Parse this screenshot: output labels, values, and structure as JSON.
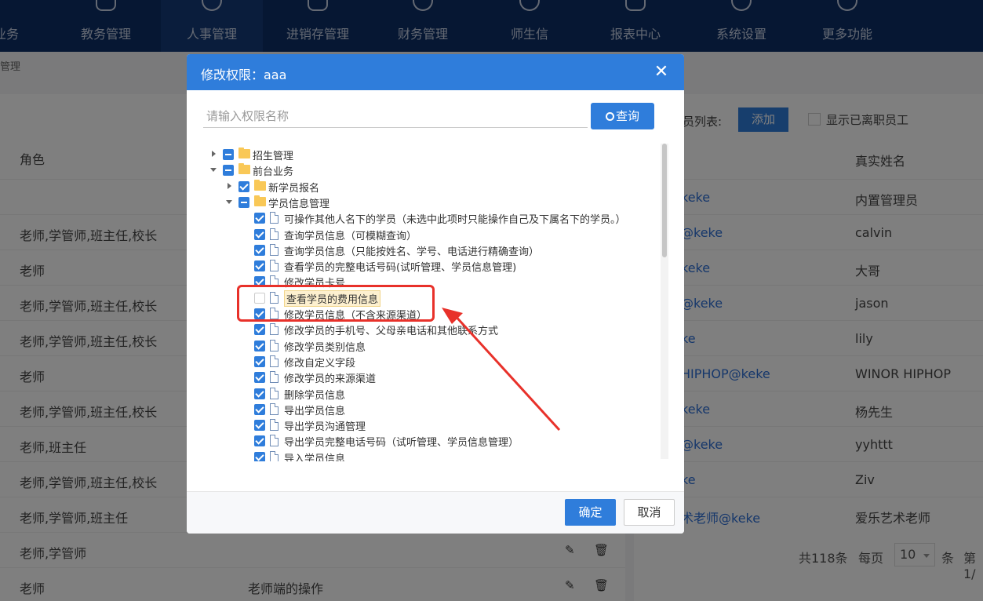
{
  "nav": {
    "items": [
      "业务",
      "教务管理",
      "人事管理",
      "进销存管理",
      "财务管理",
      "师生信",
      "报表中心",
      "系统设置",
      "更多功能"
    ],
    "active_index": 2
  },
  "breadcrumb": "管理",
  "background": {
    "left_header": "角色",
    "left_rows": [
      {
        "role": "",
        "desc": ""
      },
      {
        "role": "老师,学管师,班主任,校长",
        "desc": ""
      },
      {
        "role": "老师",
        "desc": ""
      },
      {
        "role": "老师,学管师,班主任,校长",
        "desc": ""
      },
      {
        "role": "老师,学管师,班主任,校长",
        "desc": ""
      },
      {
        "role": "老师",
        "desc": ""
      },
      {
        "role": "老师,学管师,班主任,校长",
        "desc": ""
      },
      {
        "role": "老师,班主任",
        "desc": ""
      },
      {
        "role": "老师,学管师,班主任,校长",
        "desc": ""
      },
      {
        "role": "老师,学管师,班主任",
        "desc": ""
      },
      {
        "role": "老师,学管师",
        "desc": ""
      },
      {
        "role": "老师",
        "desc": "老师端的操作"
      }
    ],
    "right_toolbar_label": "员列表:",
    "right_add_button": "添加",
    "right_checkbox_label": "显示已离职员工",
    "right_header": "真实姓名",
    "right_rows": [
      {
        "account": "keke",
        "name": "内置管理员"
      },
      {
        "account": "@keke",
        "name": "calvin"
      },
      {
        "account": "keke",
        "name": "大哥"
      },
      {
        "account": "@keke",
        "name": "jason"
      },
      {
        "account": "ke",
        "name": "lily"
      },
      {
        "account": "HIPHOP@keke",
        "name": "WINOR HIPHOP"
      },
      {
        "account": "keke",
        "name": "杨先生"
      },
      {
        "account": "@keke",
        "name": "yyhttt"
      },
      {
        "account": "ke",
        "name": "Ziv"
      },
      {
        "account": "术老师@keke",
        "name": "爱乐艺术老师"
      }
    ],
    "pagination": {
      "total": "共118条",
      "per_page_label": "每页",
      "per_page": "10",
      "unit": "条",
      "page": "第1/"
    }
  },
  "dialog": {
    "title": "修改权限：aaa",
    "search_placeholder": "请输入权限名称",
    "search_button": "查询",
    "tree": [
      {
        "label": "招生管理",
        "level": 0,
        "type": "folder",
        "caret": "right",
        "check": "partial"
      },
      {
        "label": "前台业务",
        "level": 0,
        "type": "folder",
        "caret": "down",
        "check": "partial"
      },
      {
        "label": "新学员报名",
        "level": 1,
        "type": "folder",
        "caret": "right",
        "check": "checked"
      },
      {
        "label": "学员信息管理",
        "level": 1,
        "type": "folder",
        "caret": "down",
        "check": "partial"
      },
      {
        "label": "可操作其他人名下的学员（未选中此项时只能操作自己及下属名下的学员。）",
        "level": 2,
        "type": "file",
        "check": "checked"
      },
      {
        "label": "查询学员信息（可模糊查询）",
        "level": 2,
        "type": "file",
        "check": "checked"
      },
      {
        "label": "查询学员信息（只能按姓名、学号、电话进行精确查询）",
        "level": 2,
        "type": "file",
        "check": "checked"
      },
      {
        "label": "查看学员的完整电话号码(试听管理、学员信息管理)",
        "level": 2,
        "type": "file",
        "check": "checked"
      },
      {
        "label": "修改学员卡号",
        "level": 2,
        "type": "file",
        "check": "checked"
      },
      {
        "label": "查看学员的费用信息",
        "level": 2,
        "type": "file",
        "check": "empty",
        "highlight": true
      },
      {
        "label": "修改学员信息（不含来源渠道）",
        "level": 2,
        "type": "file",
        "check": "checked"
      },
      {
        "label": "修改学员的手机号、父母亲电话和其他联系方式",
        "level": 2,
        "type": "file",
        "check": "checked"
      },
      {
        "label": "修改学员类别信息",
        "level": 2,
        "type": "file",
        "check": "checked"
      },
      {
        "label": "修改自定义字段",
        "level": 2,
        "type": "file",
        "check": "checked"
      },
      {
        "label": "修改学员的来源渠道",
        "level": 2,
        "type": "file",
        "check": "checked"
      },
      {
        "label": "删除学员信息",
        "level": 2,
        "type": "file",
        "check": "checked"
      },
      {
        "label": "导出学员信息",
        "level": 2,
        "type": "file",
        "check": "checked"
      },
      {
        "label": "导出学员沟通管理",
        "level": 2,
        "type": "file",
        "check": "checked"
      },
      {
        "label": "导出学员完整电话号码（试听管理、学员信息管理）",
        "level": 2,
        "type": "file",
        "check": "checked"
      },
      {
        "label": "导入学员信息",
        "level": 2,
        "type": "file",
        "check": "checked"
      }
    ],
    "ok_button": "确定",
    "cancel_button": "取消"
  },
  "colors": {
    "primary": "#2f7ddb",
    "nav_bg": "#0d2e66",
    "annotation": "#e8312a",
    "highlight": "#fdf0cf"
  }
}
